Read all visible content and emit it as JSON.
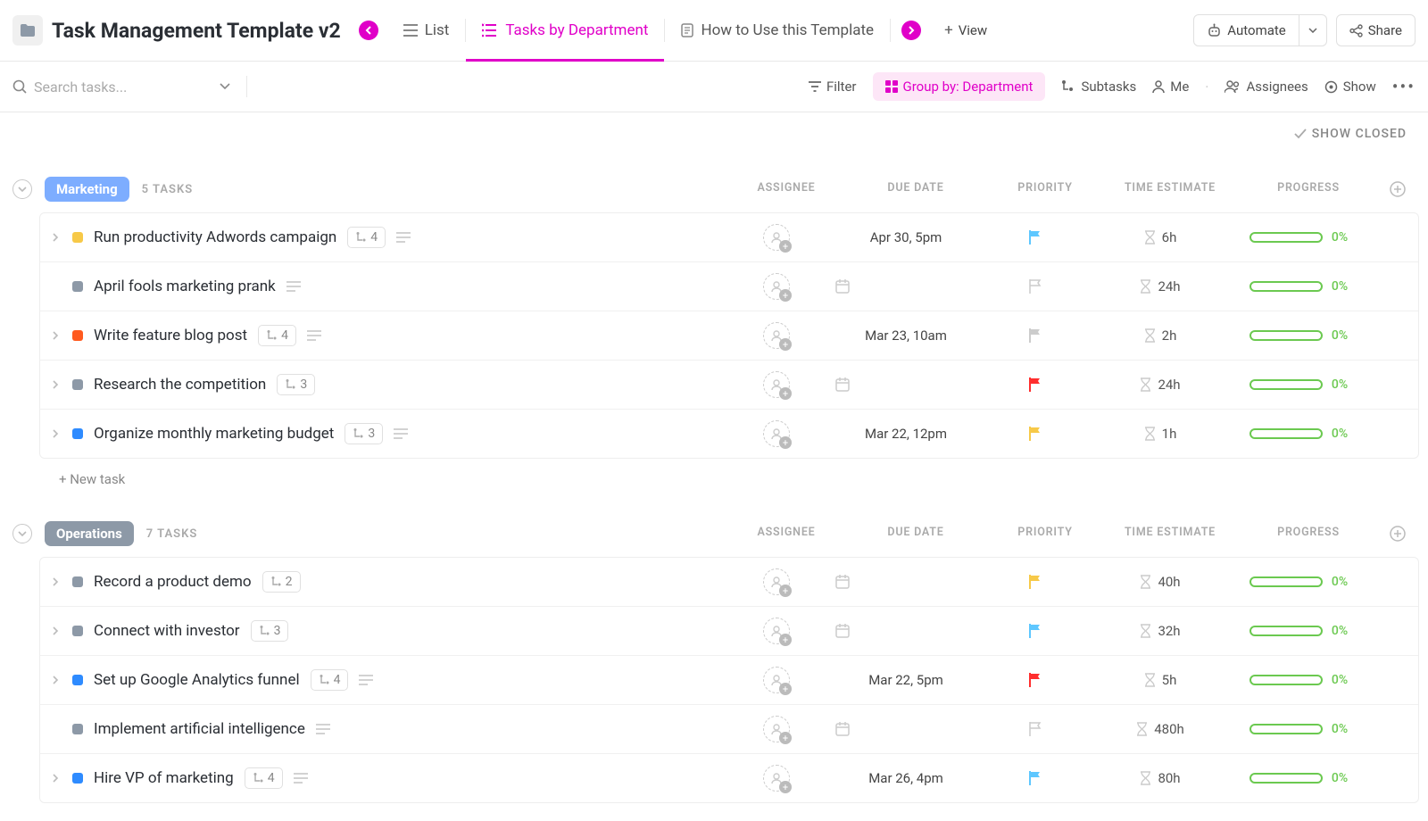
{
  "header": {
    "title": "Task Management Template v2",
    "views": [
      {
        "label": "List",
        "icon": "list",
        "active": false,
        "pinned": false
      },
      {
        "label": "Tasks by Department",
        "icon": "list-indent",
        "active": true,
        "pinned": true
      },
      {
        "label": "How to Use this Template",
        "icon": "doc",
        "active": false,
        "pinned": false
      }
    ],
    "view_button": "View",
    "automate_button": "Automate",
    "share_button": "Share"
  },
  "toolbar": {
    "search_placeholder": "Search tasks...",
    "filter": "Filter",
    "group_by": "Group by: Department",
    "subtasks": "Subtasks",
    "me": "Me",
    "assignees": "Assignees",
    "show": "Show"
  },
  "show_closed": "SHOW CLOSED",
  "columns": {
    "assignee": "ASSIGNEE",
    "due_date": "DUE DATE",
    "priority": "PRIORITY",
    "time_estimate": "TIME ESTIMATE",
    "progress": "PROGRESS"
  },
  "groups": [
    {
      "name": "Marketing",
      "pill_class": "marketing",
      "task_count_label": "5 TASKS",
      "tasks": [
        {
          "expandable": true,
          "status_color": "#f7c948",
          "name": "Run productivity Adwords campaign",
          "subtasks": 4,
          "has_desc": true,
          "due": "Apr 30, 5pm",
          "priority_color": "#5ec7ff",
          "priority_empty": false,
          "time": "6h",
          "progress": "0%"
        },
        {
          "expandable": false,
          "status_color": "#8d99a7",
          "name": "April fools marketing prank",
          "subtasks": null,
          "has_desc": true,
          "due": null,
          "priority_color": "#ccc",
          "priority_empty": true,
          "time": "24h",
          "progress": "0%"
        },
        {
          "expandable": true,
          "status_color": "#ff5a1f",
          "name": "Write feature blog post",
          "subtasks": 4,
          "has_desc": true,
          "due": "Mar 23, 10am",
          "priority_color": "#ccc",
          "priority_empty": false,
          "time": "2h",
          "progress": "0%"
        },
        {
          "expandable": true,
          "status_color": "#8d99a7",
          "name": "Research the competition",
          "subtasks": 3,
          "has_desc": false,
          "due": null,
          "priority_color": "#ff2e2e",
          "priority_empty": false,
          "time": "24h",
          "progress": "0%"
        },
        {
          "expandable": true,
          "status_color": "#2e8bff",
          "name": "Organize monthly marketing budget",
          "subtasks": 3,
          "has_desc": true,
          "due": "Mar 22, 12pm",
          "priority_color": "#f7c948",
          "priority_empty": false,
          "time": "1h",
          "progress": "0%"
        }
      ]
    },
    {
      "name": "Operations",
      "pill_class": "operations",
      "task_count_label": "7 TASKS",
      "tasks": [
        {
          "expandable": true,
          "status_color": "#8d99a7",
          "name": "Record a product demo",
          "subtasks": 2,
          "has_desc": false,
          "due": null,
          "priority_color": "#f7c948",
          "priority_empty": false,
          "time": "40h",
          "progress": "0%"
        },
        {
          "expandable": true,
          "status_color": "#8d99a7",
          "name": "Connect with investor",
          "subtasks": 3,
          "has_desc": false,
          "due": null,
          "priority_color": "#5ec7ff",
          "priority_empty": false,
          "time": "32h",
          "progress": "0%"
        },
        {
          "expandable": true,
          "status_color": "#2e8bff",
          "name": "Set up Google Analytics funnel",
          "subtasks": 4,
          "has_desc": true,
          "due": "Mar 22, 5pm",
          "priority_color": "#ff2e2e",
          "priority_empty": false,
          "time": "5h",
          "progress": "0%"
        },
        {
          "expandable": false,
          "status_color": "#8d99a7",
          "name": "Implement artificial intelligence",
          "subtasks": null,
          "has_desc": true,
          "due": null,
          "priority_color": "#ccc",
          "priority_empty": true,
          "time": "480h",
          "progress": "0%"
        },
        {
          "expandable": true,
          "status_color": "#2e8bff",
          "name": "Hire VP of marketing",
          "subtasks": 4,
          "has_desc": true,
          "due": "Mar 26, 4pm",
          "priority_color": "#5ec7ff",
          "priority_empty": false,
          "time": "80h",
          "progress": "0%"
        }
      ]
    }
  ],
  "new_task": "+ New task"
}
